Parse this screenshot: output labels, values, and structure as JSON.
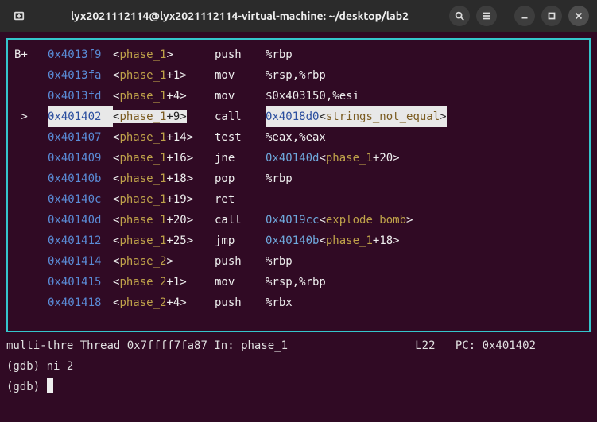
{
  "window": {
    "title": "lyx2021112114@lyx2021112114-virtual-machine: ~/desktop/lab2"
  },
  "disasm": {
    "breakpoint_marker": "B+",
    "current_marker": " >",
    "lines": [
      {
        "bp": "B+",
        "cur": false,
        "addr": "0x4013f9",
        "sym": "phase_1",
        "off": "",
        "mnem": "push",
        "args": "%rbp"
      },
      {
        "bp": "",
        "cur": false,
        "addr": "0x4013fa",
        "sym": "phase_1",
        "off": "+1",
        "mnem": "mov",
        "args": "%rsp,%rbp"
      },
      {
        "bp": "",
        "cur": false,
        "addr": "0x4013fd",
        "sym": "phase_1",
        "off": "+4",
        "mnem": "mov",
        "args": "$0x403150,%esi"
      },
      {
        "bp": "",
        "cur": true,
        "addr": "0x401402",
        "sym": "phase_1",
        "off": "+9",
        "mnem": "call",
        "args": "",
        "target_addr": "0x4018d0",
        "target_sym": "strings_not_equal",
        "target_off": ""
      },
      {
        "bp": "",
        "cur": false,
        "addr": "0x401407",
        "sym": "phase_1",
        "off": "+14",
        "mnem": "test",
        "args": "%eax,%eax"
      },
      {
        "bp": "",
        "cur": false,
        "addr": "0x401409",
        "sym": "phase_1",
        "off": "+16",
        "mnem": "jne",
        "args": "",
        "target_addr": "0x40140d",
        "target_sym": "phase_1",
        "target_off": "+20"
      },
      {
        "bp": "",
        "cur": false,
        "addr": "0x40140b",
        "sym": "phase_1",
        "off": "+18",
        "mnem": "pop",
        "args": "%rbp"
      },
      {
        "bp": "",
        "cur": false,
        "addr": "0x40140c",
        "sym": "phase_1",
        "off": "+19",
        "mnem": "ret",
        "args": ""
      },
      {
        "bp": "",
        "cur": false,
        "addr": "0x40140d",
        "sym": "phase_1",
        "off": "+20",
        "mnem": "call",
        "args": "",
        "target_addr": "0x4019cc",
        "target_sym": "explode_bomb",
        "target_off": ""
      },
      {
        "bp": "",
        "cur": false,
        "addr": "0x401412",
        "sym": "phase_1",
        "off": "+25",
        "mnem": "jmp",
        "args": "",
        "target_addr": "0x40140b",
        "target_sym": "phase_1",
        "target_off": "+18"
      },
      {
        "bp": "",
        "cur": false,
        "addr": "0x401414",
        "sym": "phase_2",
        "off": "",
        "mnem": "push",
        "args": "%rbp"
      },
      {
        "bp": "",
        "cur": false,
        "addr": "0x401415",
        "sym": "phase_2",
        "off": "+1",
        "mnem": "mov",
        "args": "%rsp,%rbp"
      },
      {
        "bp": "",
        "cur": false,
        "addr": "0x401418",
        "sym": "phase_2",
        "off": "+4",
        "mnem": "push",
        "args": "%rbx"
      }
    ]
  },
  "status": {
    "thread_model": "multi-thre",
    "thread_label": "Thread",
    "thread_id": "0x7ffff7fa87",
    "in_label": "In:",
    "func": "phase_1",
    "line_label": "L22",
    "pc_label": "PC:",
    "pc": "0x401402"
  },
  "gdb": {
    "prompt": "(gdb) ",
    "prev_cmd": "ni 2"
  }
}
